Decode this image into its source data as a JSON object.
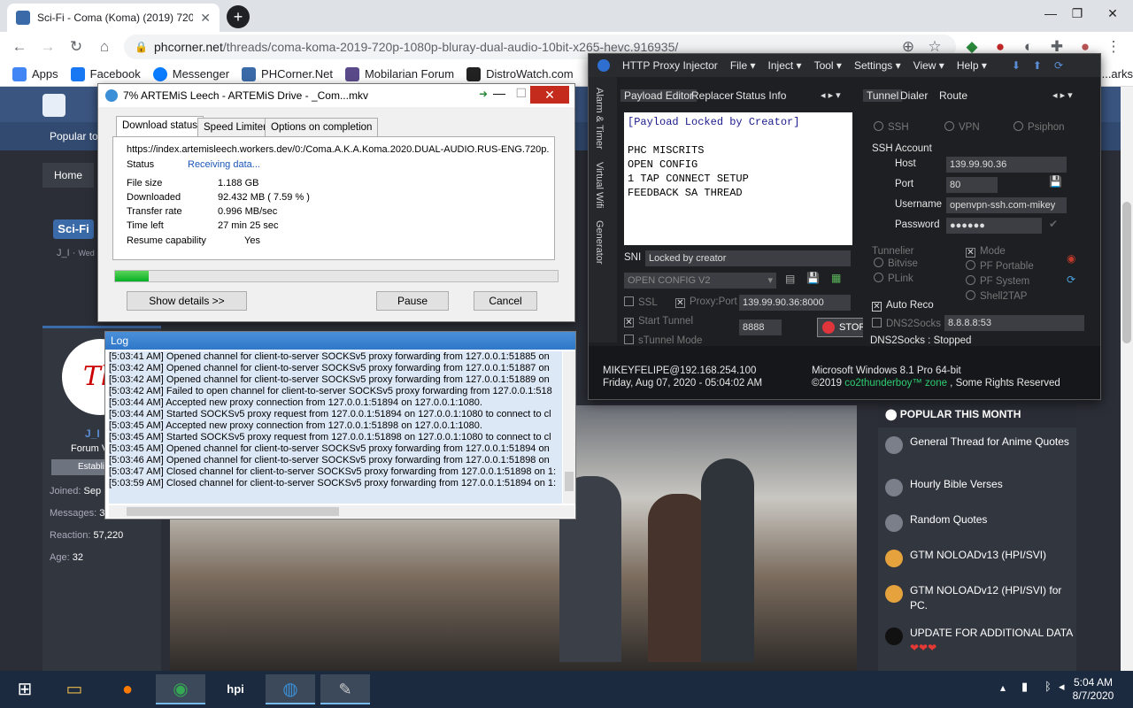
{
  "browser": {
    "tab_title": "Sci-Fi - Coma (Koma) (2019) 720p",
    "new_tab_symbol": "+",
    "url_host": "phcorner.net",
    "url_path": "/threads/coma-koma-2019-720p-1080p-bluray-dual-audio-10bit-x265-hevc.916935/",
    "bookmarks": [
      "Apps",
      "Facebook",
      "Messenger",
      "PHCorner.Net",
      "Mobilarian Forum",
      "DistroWatch.com",
      "...arks"
    ]
  },
  "site": {
    "nav_popular": "Popular to",
    "breadcrumb_home": "Home",
    "badge": "Sci-Fi",
    "author_short": "J_I",
    "author_date": "Wed",
    "profile": {
      "name": "J_I",
      "role": "Forum V",
      "banner": "Establi",
      "joined_label": "Joined:",
      "joined_value": "Sep",
      "messages_label": "Messages:",
      "messages_value": "3",
      "reaction_label": "Reaction:",
      "reaction_value": "57,220",
      "age_label": "Age:",
      "age_value": "32"
    },
    "popular": {
      "title": "POPULAR THIS MONTH",
      "items": [
        {
          "text": "General Thread for Anime Quotes",
          "color": "#7a7f8a"
        },
        {
          "text": "Hourly Bible Verses",
          "color": "#7a7f8a"
        },
        {
          "text": "Random Quotes",
          "color": "#7a7f8a"
        },
        {
          "text": "GTM NOLOADv13 (HPI/SVI)",
          "color": "#e6a23c"
        },
        {
          "text": "GTM NOLOADv12 (HPI/SVI) for PC.",
          "color": "#e6a23c"
        },
        {
          "text": "UPDATE FOR ADDITIONAL DATA",
          "color": "#1a1a1a"
        }
      ]
    }
  },
  "artemis": {
    "title": "7% ARTEMiS Leech - ARTEMiS Drive - _Com...mkv",
    "tabs": [
      "Download status",
      "Speed Limiter",
      "Options on completion"
    ],
    "url": "https://index.artemisleech.workers.dev/0:/Coma.A.K.A.Koma.2020.DUAL-AUDIO.RUS-ENG.720p.",
    "status_label": "Status",
    "status_value": "Receiving data...",
    "rows": [
      {
        "label": "File size",
        "value": "1.188  GB"
      },
      {
        "label": "Downloaded",
        "value": "92.432  MB  ( 7.59 % )"
      },
      {
        "label": "Transfer rate",
        "value": "0.996  MB/sec"
      },
      {
        "label": "Time left",
        "value": "27 min 25 sec"
      },
      {
        "label": "Resume capability",
        "value": "Yes"
      }
    ],
    "progress_percent": 7.59,
    "buttons": {
      "details": "Show details >>",
      "pause": "Pause",
      "cancel": "Cancel"
    }
  },
  "log": {
    "title": "Log",
    "lines": [
      "[5:03:41 AM] Opened channel for client-to-server SOCKSv5 proxy forwarding from 127.0.0.1:51885 on",
      "[5:03:42 AM] Opened channel for client-to-server SOCKSv5 proxy forwarding from 127.0.0.1:51887 on",
      "[5:03:42 AM] Opened channel for client-to-server SOCKSv5 proxy forwarding from 127.0.0.1:51889 on",
      "[5:03:42 AM] Failed to open channel for client-to-server SOCKSv5 proxy forwarding from 127.0.0.1:518",
      "[5:03:44 AM] Accepted new proxy connection from 127.0.0.1:51894 on 127.0.0.1:1080.",
      "[5:03:44 AM] Started SOCKSv5 proxy request from 127.0.0.1:51894 on 127.0.0.1:1080 to connect to cl",
      "[5:03:45 AM] Accepted new proxy connection from 127.0.0.1:51898 on 127.0.0.1:1080.",
      "[5:03:45 AM] Started SOCKSv5 proxy request from 127.0.0.1:51898 on 127.0.0.1:1080 to connect to cl",
      "[5:03:45 AM] Opened channel for client-to-server SOCKSv5 proxy forwarding from 127.0.0.1:51894 on",
      "[5:03:46 AM] Opened channel for client-to-server SOCKSv5 proxy forwarding from 127.0.0.1:51898 on",
      "[5:03:47 AM] Closed channel for client-to-server SOCKSv5 proxy forwarding from 127.0.0.1:51898 on 1:",
      "[5:03:59 AM] Closed channel for client-to-server SOCKSv5 proxy forwarding from 127.0.0.1:51894 on 1:"
    ]
  },
  "injector": {
    "title": "HTTP Proxy Injector",
    "menus": [
      "File",
      "Inject",
      "Tool",
      "Settings",
      "View",
      "Help"
    ],
    "side_tabs": [
      "Alarm & Timer",
      "Virtual Wifi",
      "Generator"
    ],
    "left_tabs": [
      "Payload Editor",
      "Replacer",
      "Status Info"
    ],
    "right_tabs": [
      "Tunnel",
      "Dialer",
      "Route"
    ],
    "payload_header": "[Payload Locked by Creator]",
    "payload_lines": [
      "PHC MISCRITS",
      "OPEN CONFIG",
      "1 TAP CONNECT SETUP",
      "FEEDBACK SA THREAD"
    ],
    "sni_label": "SNI",
    "sni_value": "Locked by creator",
    "config_select": "OPEN CONFIG V2",
    "ssl_label": "SSL",
    "proxy_port_label": "Proxy:Port",
    "proxy_port_value": "139.99.90.36:8000",
    "start_tunnel_label": "Start Tunnel",
    "stunnel_label": "sTunnel Mode",
    "local_port": "8888",
    "stop_label": "STOP",
    "modes": [
      "SSH",
      "VPN",
      "Psiphon"
    ],
    "ssh_account_label": "SSH Account",
    "host_label": "Host",
    "host_value": "139.99.90.36",
    "port_label": "Port",
    "port_value": "80",
    "username_label": "Username",
    "username_value": "openvpn-ssh.com-mikey",
    "password_label": "Password",
    "password_value": "●●●●●●",
    "tunnelier_label": "Tunnelier",
    "tunnelier_options": [
      "Bitvise",
      "PLink"
    ],
    "mode_label": "Mode",
    "mode_options": [
      "PF Portable",
      "PF System",
      "Shell2TAP"
    ],
    "auto_reco_label": "Auto Reco",
    "dns2socks_label": "DNS2Socks",
    "dns_value": "8.8.8.8:53",
    "dns_status": "DNS2Socks : Stopped",
    "status_user": "MIKEYFELIPE@192.168.254.100",
    "status_date": "Friday, Aug 07, 2020 - 05:04:02 AM",
    "status_os": "Microsoft Windows 8.1 Pro 64-bit",
    "status_copyright_pre": "©2019 ",
    "status_copyright_link": "co2thunderboy™ zone",
    "status_copyright_post": " , Some Rights Reserved"
  },
  "taskbar": {
    "time": "5:04 AM",
    "date": "8/7/2020"
  }
}
